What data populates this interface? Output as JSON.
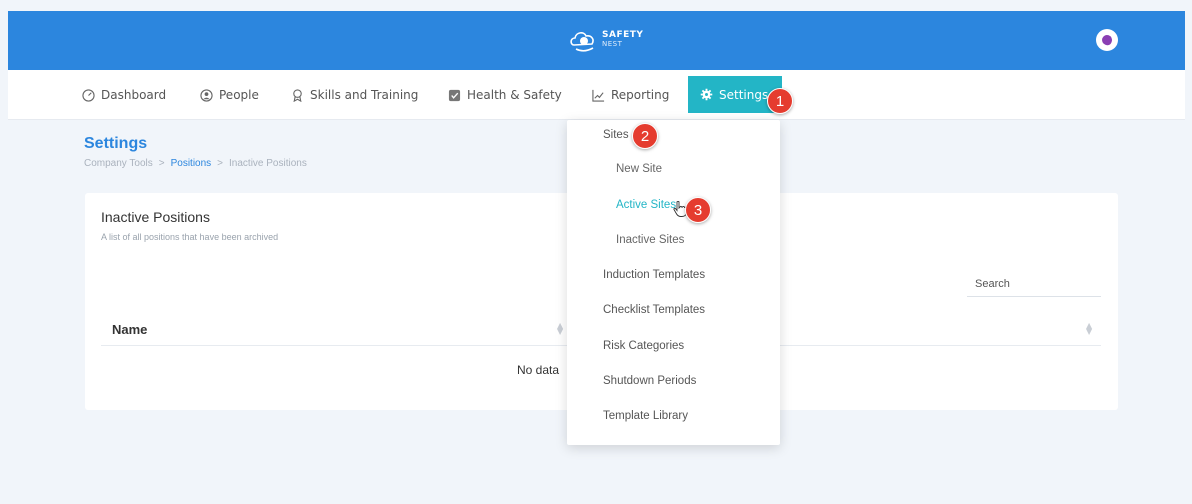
{
  "header": {
    "logo_line1": "SAFETY",
    "logo_line2": "NEST",
    "avatar_icon": "user-avatar-icon",
    "brand_color": "#2c86de"
  },
  "nav": {
    "items": [
      {
        "label": "Dashboard",
        "icon": "dashboard-icon"
      },
      {
        "label": "People",
        "icon": "person-icon"
      },
      {
        "label": "Skills and Training",
        "icon": "award-icon"
      },
      {
        "label": "Health & Safety",
        "icon": "checkbox-icon"
      },
      {
        "label": "Reporting",
        "icon": "chart-line-icon"
      },
      {
        "label": "Settings",
        "icon": "gear-icon",
        "active": true
      }
    ],
    "active_color": "#23b5c6"
  },
  "page": {
    "title": "Settings",
    "breadcrumb": [
      "Company Tools",
      "Positions",
      "Inactive Positions"
    ],
    "breadcrumb_sep": ">"
  },
  "card": {
    "title": "Inactive Positions",
    "subtitle": "A list of all positions that have been archived",
    "search_label": "Search",
    "column_name": "Name",
    "empty_message": "No data"
  },
  "dropdown": {
    "items": [
      {
        "label": "Sites",
        "level": 0
      },
      {
        "label": "New Site",
        "level": 1
      },
      {
        "label": "Active Sites",
        "level": 1,
        "highlight": true
      },
      {
        "label": "Inactive Sites",
        "level": 1
      },
      {
        "label": "Induction Templates",
        "level": 0
      },
      {
        "label": "Checklist Templates",
        "level": 0
      },
      {
        "label": "Risk Categories",
        "level": 0
      },
      {
        "label": "Shutdown Periods",
        "level": 0
      },
      {
        "label": "Template Library",
        "level": 0
      }
    ]
  },
  "markers": [
    "1",
    "2",
    "3"
  ],
  "marker_color": "#e53c2f"
}
